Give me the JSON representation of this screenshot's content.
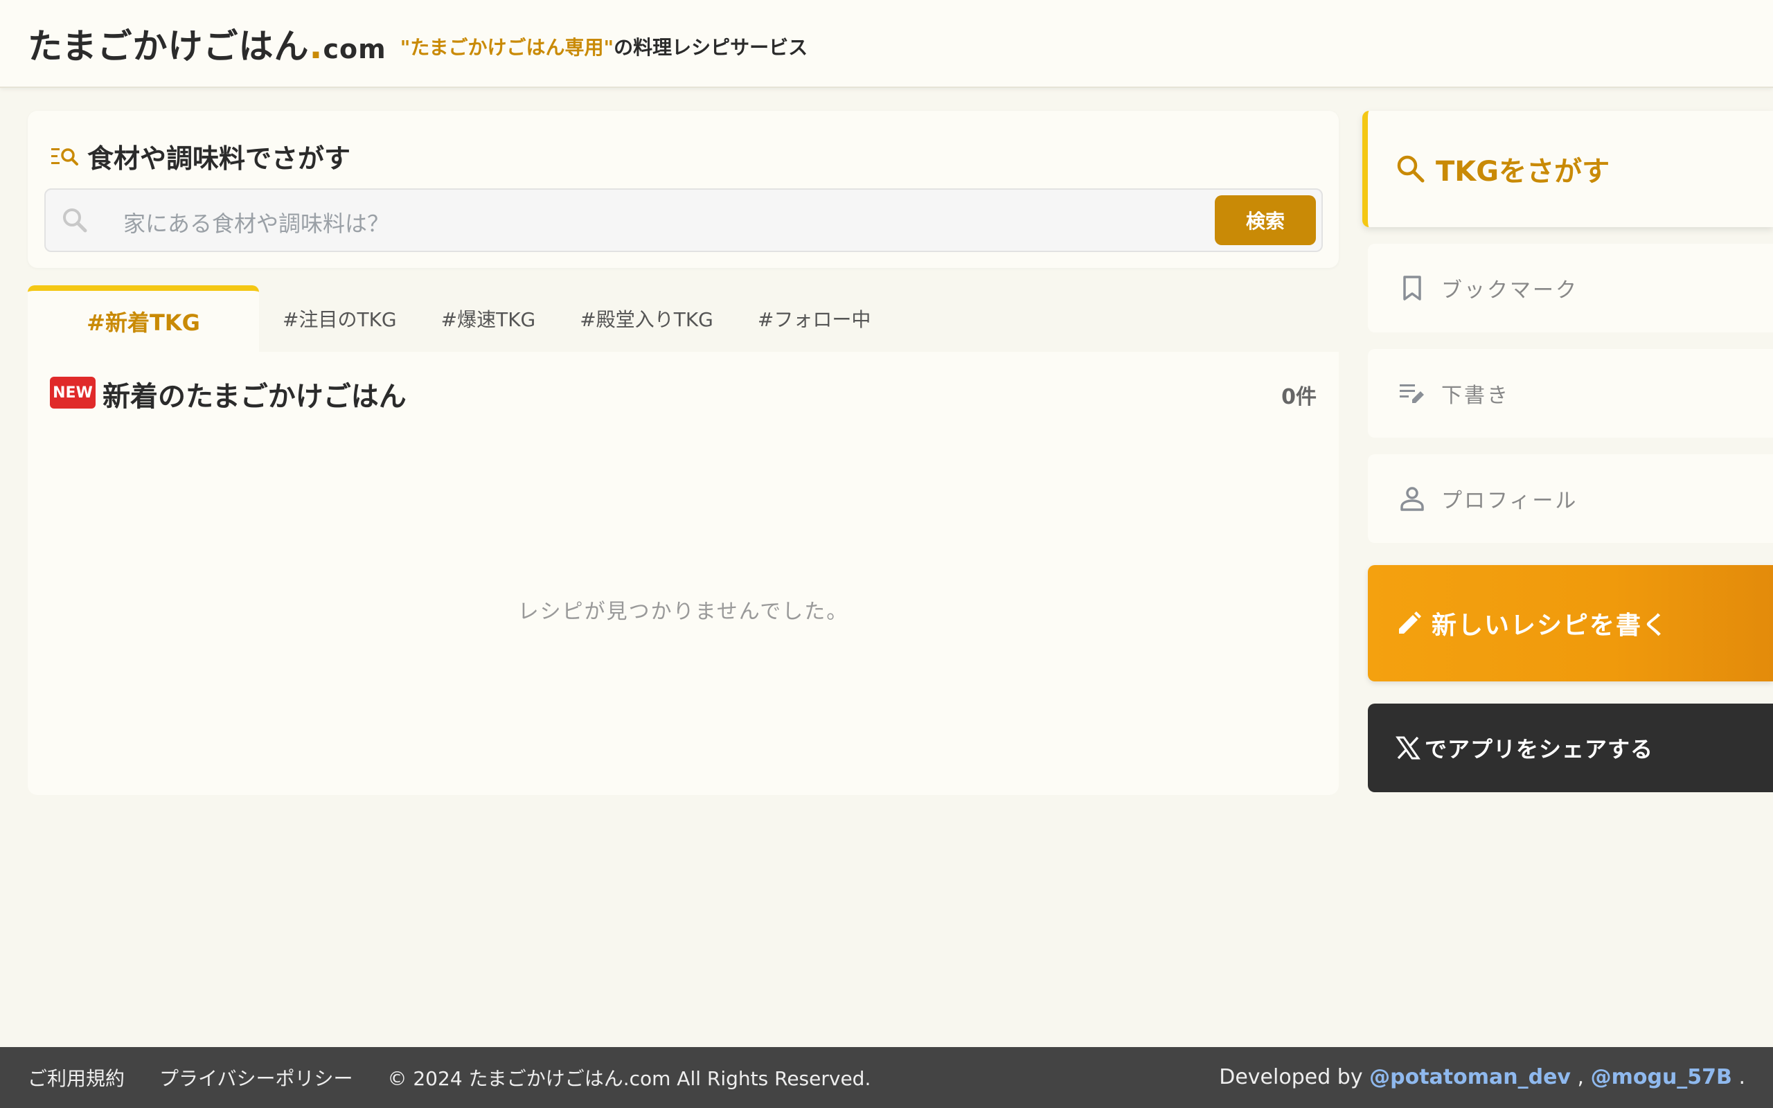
{
  "header": {
    "logo_main": "たまごかけごはん",
    "logo_dot": ".",
    "logo_com": "com",
    "tagline_highlight": "\"たまごかけごはん専用\"",
    "tagline_rest": "の料理レシピサービス"
  },
  "search": {
    "title": "食材や調味料でさがす",
    "placeholder": "家にある食材や調味料は？",
    "button_label": "検索"
  },
  "tabs": [
    {
      "label": "#新着TKG",
      "active": true
    },
    {
      "label": "#注目のTKG",
      "active": false
    },
    {
      "label": "#爆速TKG",
      "active": false
    },
    {
      "label": "#殿堂入りTKG",
      "active": false
    },
    {
      "label": "#フォロー中",
      "active": false
    }
  ],
  "recipes": {
    "badge": "NEW",
    "title": "新着のたまごかけごはん",
    "count": "0件",
    "empty_message": "レシピが見つかりませんでした。"
  },
  "sidebar": {
    "search_label": "TKGをさがす",
    "items": [
      {
        "label": "ブックマーク",
        "icon": "bookmark-icon"
      },
      {
        "label": "下書き",
        "icon": "draft-icon"
      },
      {
        "label": "プロフィール",
        "icon": "user-icon"
      }
    ],
    "write_label": "新しいレシピを書く",
    "share_label": "でアプリをシェアする"
  },
  "footer": {
    "terms": "ご利用規約",
    "privacy": "プライバシーポリシー",
    "copyright": "© 2024 たまごかけごはん.com All Rights Reserved.",
    "developed_by": "Developed by ",
    "dev1": "@potatoman_dev",
    "separator": " , ",
    "dev2": "@mogu_57B",
    "end": " ."
  },
  "colors": {
    "accent": "#c98a06",
    "tab_underline": "#f4c714",
    "write_button": "#f09a0c",
    "share_button": "#2f2f2f",
    "footer_bg": "#444444",
    "new_badge": "#e02a2a"
  }
}
